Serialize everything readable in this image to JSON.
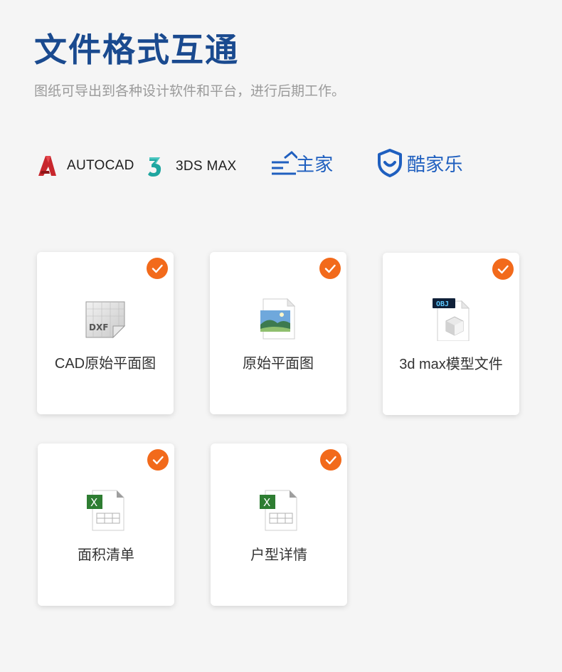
{
  "header": {
    "title": "文件格式互通",
    "subtitle": "图纸可导出到各种设计软件和平台，进行后期工作。"
  },
  "logos": [
    {
      "name": "AUTOCAD",
      "icon": "autocad-icon"
    },
    {
      "name": "3DS MAX",
      "icon": "3dsmax-icon"
    },
    {
      "name": "主家",
      "icon": "sanjia-logo-icon"
    },
    {
      "name": "酷家乐",
      "icon": "kujiale-logo-icon"
    }
  ],
  "cards": [
    {
      "label": "CAD原始平面图",
      "icon": "dxf-file-icon",
      "checked": true
    },
    {
      "label": "原始平面图",
      "icon": "image-file-icon",
      "checked": true
    },
    {
      "label": "3d max模型文件",
      "icon": "obj-file-icon",
      "checked": true
    },
    {
      "label": "面积清单",
      "icon": "excel-file-icon",
      "checked": true
    },
    {
      "label": "户型详情",
      "icon": "excel-file-icon",
      "checked": true
    }
  ],
  "icon_texts": {
    "dxf": "DXF",
    "obj": "OBJ",
    "excel": "X"
  },
  "colors": {
    "title": "#1a4a8f",
    "check": "#f26a1b",
    "logo_blue": "#1f5fbf",
    "autocad_red": "#c8272d",
    "max_teal": "#1fa6a0",
    "excel_green": "#2e7d32"
  }
}
